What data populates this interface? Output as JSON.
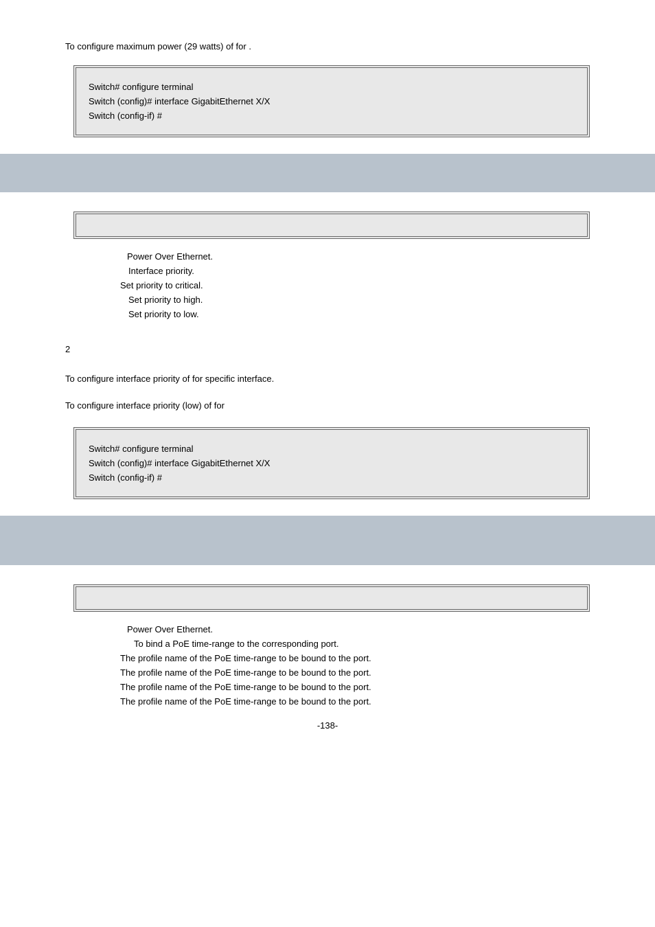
{
  "intro1": {
    "prefix": "To configure maximum power (29 watts) of ",
    "mid": " for ",
    "suffix": "."
  },
  "codebox1": {
    "lines": [
      "Switch# configure terminal",
      "Switch (config)# interface GigabitEthernet X/X",
      "Switch (config-if) #"
    ]
  },
  "section1": {
    "params": [
      "Power Over Ethernet.",
      "Interface priority.",
      "Set priority to critical.",
      "Set priority to high.",
      "Set priority to low."
    ],
    "default_value": "2",
    "usage_prefix": "To configure interface priority of ",
    "usage_suffix": " for specific interface.",
    "example_prefix": "To configure interface priority (low) of ",
    "example_mid": " for "
  },
  "codebox2": {
    "lines": [
      "Switch# configure terminal",
      "Switch (config)# interface GigabitEthernet X/X",
      "Switch (config-if) #"
    ]
  },
  "section2": {
    "params": [
      "Power Over Ethernet.",
      "To bind a PoE time-range to the corresponding port.",
      "The profile name of the PoE time-range to be bound to the port.",
      "The profile name of the PoE time-range to be bound to the port.",
      "The profile name of the PoE time-range to be bound to the port.",
      "The profile name of the PoE time-range to be bound to the port."
    ]
  },
  "page_number": "-138-"
}
